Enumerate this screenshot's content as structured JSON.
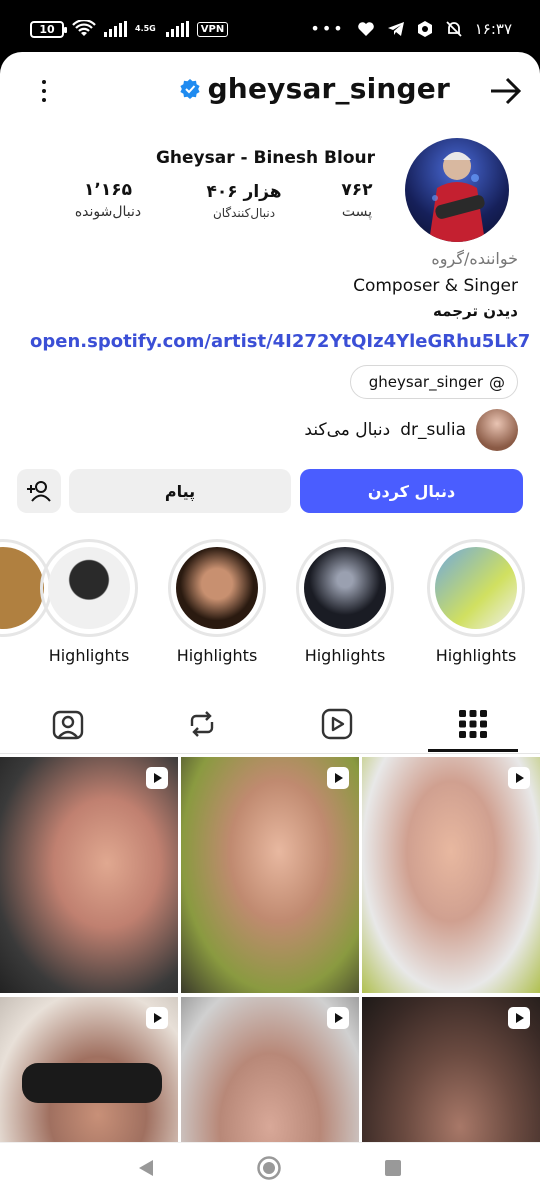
{
  "status_bar": {
    "battery": "10",
    "network": "4.5G",
    "vpn": "VPN",
    "time": "۱۶:۳۷",
    "icons": [
      "wifi-icon",
      "signal-icon",
      "ellipsis-icon",
      "heart-icon",
      "telegram-icon",
      "hexagon-icon",
      "mute-bell-icon"
    ]
  },
  "header": {
    "username": "gheysar_singer",
    "verified": true,
    "menu_icon": "kebab-icon",
    "forward_icon": "arrow-right-icon",
    "accent": "#1f8bf0"
  },
  "profile": {
    "full_name": "Gheysar - Binesh Blour",
    "stats": {
      "posts_count": "۷۶۲",
      "posts_label": "پست",
      "followers_count": "۴۰۶ هزار",
      "followers_label": "دنبال‌کنندگان",
      "following_count": "۱٬۱۶۵",
      "following_label": "دنبال‌شونده"
    },
    "category": "خواننده/گروه",
    "bio": "Composer & Singer",
    "translate": "دیدن ترجمه",
    "link": "open.spotify.com/artist/4I272YtQIz4YleGRhu5Lk7",
    "threads_handle": "gheysar_singer",
    "followed_by_user": "dr_sulia",
    "followed_by_text": "دنبال می‌کند"
  },
  "actions": {
    "follow": "دنبال کردن",
    "message": "پیام",
    "follow_color": "#4a5dff"
  },
  "highlights": [
    {
      "label": "Highlights"
    },
    {
      "label": "Highlights"
    },
    {
      "label": "Highlights"
    },
    {
      "label": "Highlights"
    }
  ],
  "tabs": [
    {
      "name": "tagged",
      "icon": "tagged-person-icon"
    },
    {
      "name": "reposts",
      "icon": "repost-icon"
    },
    {
      "name": "reels",
      "icon": "reels-icon"
    },
    {
      "name": "grid",
      "icon": "grid-icon",
      "selected": true
    }
  ],
  "grid_items": 6,
  "navigation": [
    "back-icon",
    "home-icon",
    "recents-icon"
  ]
}
